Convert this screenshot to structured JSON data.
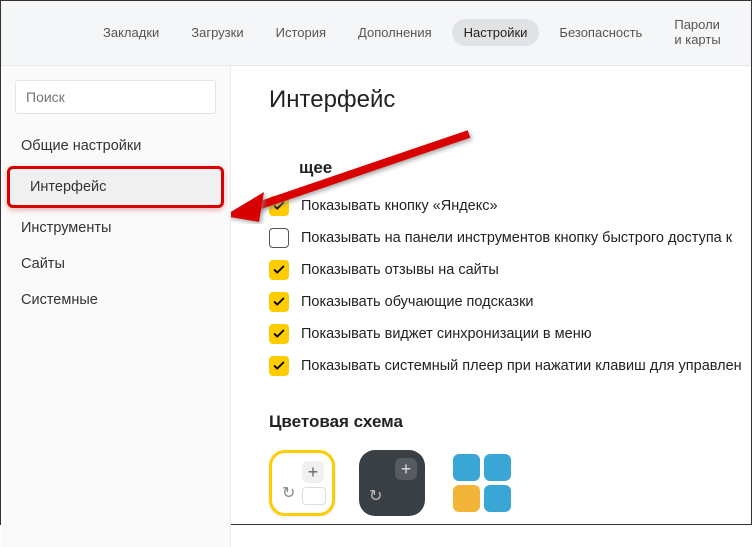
{
  "topnav": {
    "items": [
      {
        "label": "Закладки"
      },
      {
        "label": "Загрузки"
      },
      {
        "label": "История"
      },
      {
        "label": "Дополнения"
      },
      {
        "label": "Настройки",
        "active": true
      },
      {
        "label": "Безопасность"
      },
      {
        "label": "Пароли и карты"
      }
    ]
  },
  "sidebar": {
    "search_placeholder": "Поиск",
    "items": [
      {
        "label": "Общие настройки"
      },
      {
        "label": "Интерфейс",
        "active": true
      },
      {
        "label": "Инструменты"
      },
      {
        "label": "Сайты"
      },
      {
        "label": "Системные"
      }
    ]
  },
  "page": {
    "title": "Интерфейс",
    "section_general": "щее",
    "options": [
      {
        "checked": true,
        "label": "Показывать кнопку «Яндекс»"
      },
      {
        "checked": false,
        "label": "Показывать на панели инструментов кнопку быстрого доступа к"
      },
      {
        "checked": true,
        "label": "Показывать отзывы на сайты"
      },
      {
        "checked": true,
        "label": "Показывать обучающие подсказки"
      },
      {
        "checked": true,
        "label": "Показывать виджет синхронизации в меню"
      },
      {
        "checked": true,
        "label": "Показывать системный плеер при нажатии клавиш для управлен"
      }
    ],
    "section_color": "Цветовая схема"
  }
}
